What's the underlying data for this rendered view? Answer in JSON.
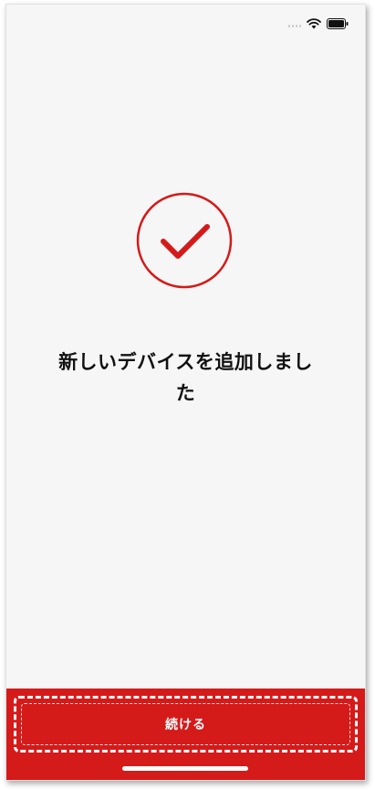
{
  "status_bar": {
    "icons": [
      "signal-icon",
      "wifi-icon",
      "battery-icon"
    ]
  },
  "main": {
    "icon": "check-circle-icon",
    "title_line1": "新しいデバイスを追加しまし",
    "title_line2": "た"
  },
  "footer": {
    "continue_label": "続ける"
  },
  "colors": {
    "accent": "#d51a1a",
    "background": "#f6f6f6",
    "text": "#111111"
  }
}
